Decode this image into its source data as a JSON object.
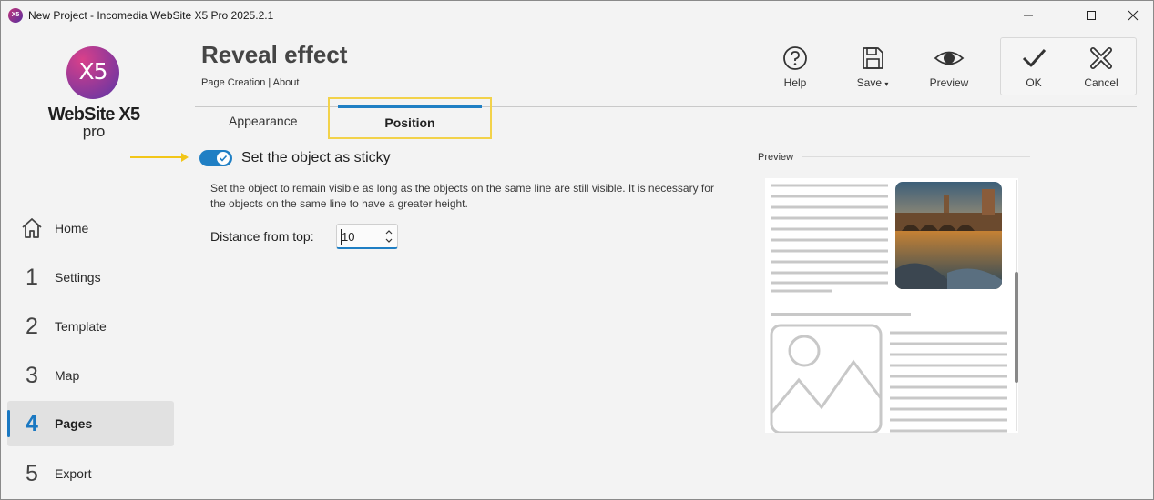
{
  "window": {
    "title": "New Project - Incomedia WebSite X5 Pro 2025.2.1",
    "app_icon_text": "X5"
  },
  "logo": {
    "mark": "X5",
    "brand": "WebSite X5",
    "edition": "pro"
  },
  "sidebar": {
    "items": [
      {
        "label": "Home",
        "icon": "home-icon"
      },
      {
        "number": "1",
        "label": "Settings"
      },
      {
        "number": "2",
        "label": "Template"
      },
      {
        "number": "3",
        "label": "Map"
      },
      {
        "number": "4",
        "label": "Pages",
        "active": true
      },
      {
        "number": "5",
        "label": "Export"
      }
    ]
  },
  "header": {
    "title": "Reveal effect",
    "breadcrumb": "Page Creation | About"
  },
  "toolbar": {
    "help": {
      "label": "Help",
      "icon": "help-icon"
    },
    "save": {
      "label": "Save",
      "icon": "save-icon"
    },
    "preview": {
      "label": "Preview",
      "icon": "eye-icon"
    },
    "ok": {
      "label": "OK",
      "icon": "check-icon"
    },
    "cancel": {
      "label": "Cancel",
      "icon": "cancel-icon"
    }
  },
  "tabs": [
    {
      "label": "Appearance",
      "active": false
    },
    {
      "label": "Position",
      "active": true
    }
  ],
  "sticky": {
    "enabled": true,
    "label": "Set the object as sticky",
    "description": "Set the object to remain visible as long as the objects on the same line are still visible. It is necessary for the objects on the same line to have a greater height."
  },
  "distance": {
    "label": "Distance from top:",
    "value": "10"
  },
  "preview_panel": {
    "label": "Preview"
  },
  "colors": {
    "accent": "#1f7fc4",
    "highlight": "#f2d24a",
    "logo_start": "#d9408a",
    "logo_end": "#5b35a6"
  }
}
